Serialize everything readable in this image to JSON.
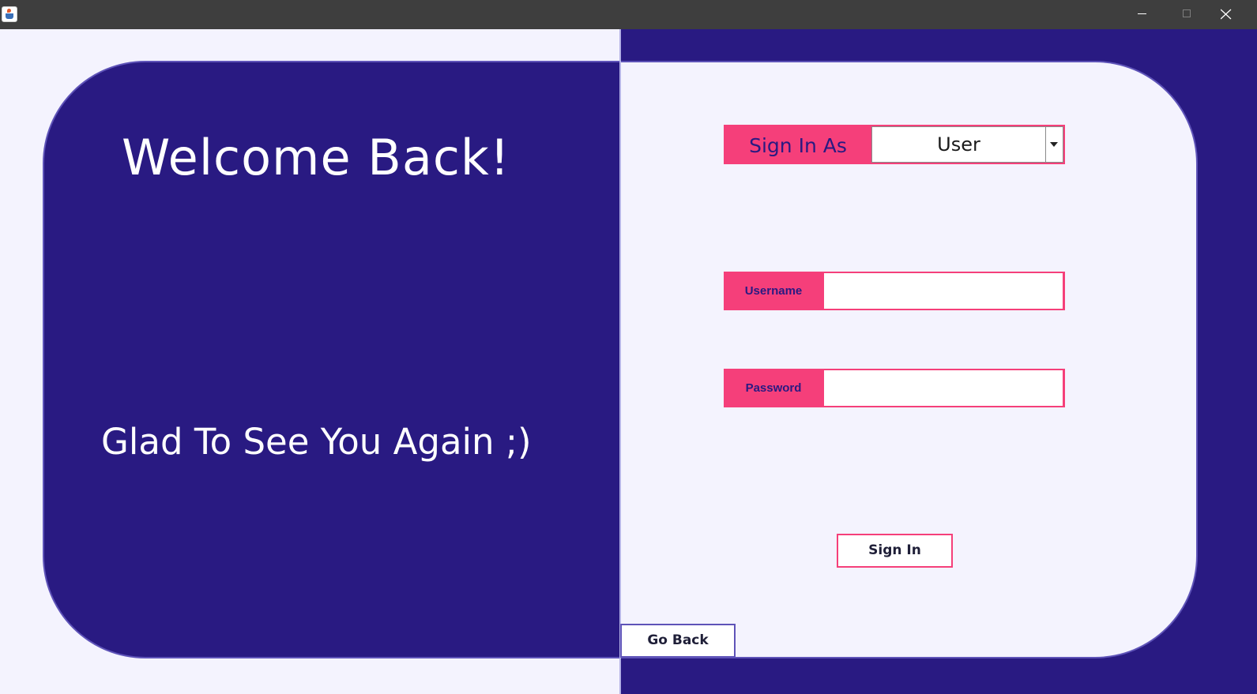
{
  "window": {
    "controls": {
      "minimize_icon": "minimize-icon",
      "maximize_icon": "maximize-icon",
      "close_icon": "close-icon"
    }
  },
  "welcome": {
    "title": "Welcome Back!",
    "subtitle": "Glad To See You Again ;)"
  },
  "signin_as": {
    "label": "Sign In As",
    "selected": "User"
  },
  "form": {
    "username_label": "Username",
    "username_value": "",
    "password_label": "Password",
    "password_value": ""
  },
  "buttons": {
    "sign_in": "Sign In",
    "go_back": "Go Back"
  },
  "colors": {
    "navy": "#291a82",
    "pink": "#f53f7a",
    "light_bg": "#f4f3fe",
    "title_bar": "#3e3e3e"
  }
}
